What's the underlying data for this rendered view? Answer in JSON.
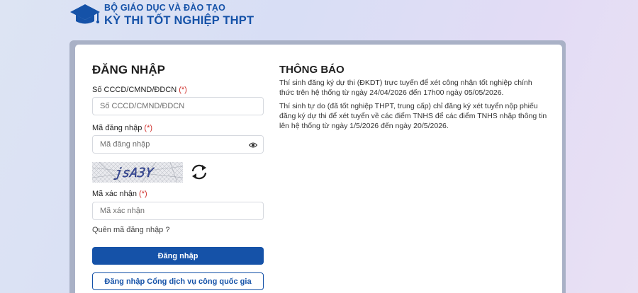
{
  "header": {
    "ministry": "BỘ GIÁO DỤC VÀ ĐÀO TẠO",
    "exam_name": "KỲ THI TỐT NGHIỆP THPT",
    "logo_icon": "graduation-cap-icon"
  },
  "login": {
    "title": "ĐĂNG NHẬP",
    "required_marker": "(*)",
    "id_label": "Số CCCD/CMND/ĐDCN",
    "id_placeholder": "Số CCCD/CMND/ĐDCN",
    "password_label": "Mã đăng nhập",
    "password_placeholder": "Mã đăng nhập",
    "captcha_text": "jsA3Y",
    "captcha_label": "Mã xác nhận",
    "captcha_placeholder": "Mã xác nhận",
    "forgot_link": "Quên mã đăng nhập ?",
    "submit_button": "Đăng nhập",
    "national_portal_button": "Đăng nhập Cổng dịch vụ công quốc gia"
  },
  "notice": {
    "title": "THÔNG BÁO",
    "paragraphs": [
      "Thí sinh đăng ký dự thi (ĐKDT) trực tuyến để xét công nhận tốt nghiệp chính thức trên hệ thống từ ngày 24/04/2026 đến 17h00 ngày 05/05/2026.",
      "Thí sinh tự do (đã tốt nghiệp THPT, trung cấp) chỉ đăng ký xét tuyển nộp phiếu đăng ký dự thi để xét tuyển về các điểm TNHS để các điểm TNHS nhập thông tin lên hệ thống từ ngày 1/5/2026 đến ngày 20/5/2026."
    ]
  },
  "colors": {
    "brand": "#1552a8",
    "required": "#d0312d"
  }
}
